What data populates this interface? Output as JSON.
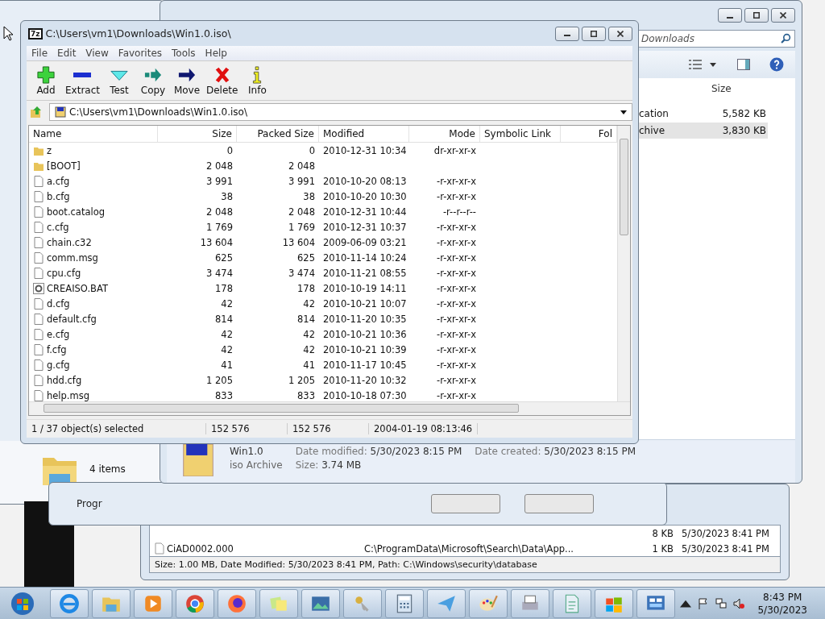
{
  "explorer_window": {
    "search": {
      "placeholder": "Downloads"
    },
    "columns": [
      "Size"
    ],
    "rows": [
      {
        "name": "cation",
        "size": "5,582 KB",
        "selected": false
      },
      {
        "name": "chive",
        "size": "3,830 KB",
        "selected": true
      }
    ],
    "details": {
      "name": "Win1.0",
      "type": "iso Archive",
      "fields": [
        {
          "label": "Date modified:",
          "value": "5/30/2023 8:15 PM"
        },
        {
          "label": "Size:",
          "value": "3.74 MB"
        },
        {
          "label": "Date created:",
          "value": "5/30/2023 8:15 PM"
        }
      ]
    }
  },
  "left_window": {
    "item_count": "4 items"
  },
  "dialog": {
    "label": "Progr"
  },
  "search_results": {
    "rows": [
      {
        "size": "8 KB",
        "modified": "5/30/2023 8:41 PM"
      },
      {
        "name": "CiAD0002.000",
        "path": "C:\\ProgramData\\Microsoft\\Search\\Data\\App...",
        "size": "1 KB",
        "modified": "5/30/2023 8:41 PM"
      }
    ],
    "status": "Size: 1.00 MB, Date Modified: 5/30/2023 8:41 PM, Path: C:\\Windows\\security\\database"
  },
  "archive_window": {
    "logo": "7z",
    "title": "C:\\Users\\vm1\\Downloads\\Win1.0.iso\\",
    "menu": [
      "File",
      "Edit",
      "View",
      "Favorites",
      "Tools",
      "Help"
    ],
    "toolbar": [
      {
        "label": "Add",
        "kind": "add"
      },
      {
        "label": "Extract",
        "kind": "extract"
      },
      {
        "label": "Test",
        "kind": "test"
      },
      {
        "label": "Copy",
        "kind": "copy"
      },
      {
        "label": "Move",
        "kind": "move"
      },
      {
        "label": "Delete",
        "kind": "delete"
      },
      {
        "label": "Info",
        "kind": "info"
      }
    ],
    "address": "C:\\Users\\vm1\\Downloads\\Win1.0.iso\\",
    "columns": [
      "Name",
      "Size",
      "Packed Size",
      "Modified",
      "Mode",
      "Symbolic Link",
      "Fol"
    ],
    "rows": [
      {
        "kind": "folder",
        "name": "z",
        "size": "0",
        "packed_size": "0",
        "modified": "2010-12-31 10:34",
        "mode": "dr-xr-xr-x"
      },
      {
        "kind": "folder",
        "name": "[BOOT]",
        "size": "2 048",
        "packed_size": "2 048"
      },
      {
        "kind": "file",
        "name": "a.cfg",
        "size": "3 991",
        "packed_size": "3 991",
        "modified": "2010-10-20 08:13",
        "mode": "-r-xr-xr-x"
      },
      {
        "kind": "file",
        "name": "b.cfg",
        "size": "38",
        "packed_size": "38",
        "modified": "2010-10-20 10:30",
        "mode": "-r-xr-xr-x"
      },
      {
        "kind": "file",
        "name": "boot.catalog",
        "size": "2 048",
        "packed_size": "2 048",
        "modified": "2010-12-31 10:44",
        "mode": "-r--r--r--"
      },
      {
        "kind": "file",
        "name": "c.cfg",
        "size": "1 769",
        "packed_size": "1 769",
        "modified": "2010-12-31 10:37",
        "mode": "-r-xr-xr-x"
      },
      {
        "kind": "file",
        "name": "chain.c32",
        "size": "13 604",
        "packed_size": "13 604",
        "modified": "2009-06-09 03:21",
        "mode": "-r-xr-xr-x"
      },
      {
        "kind": "file",
        "name": "comm.msg",
        "size": "625",
        "packed_size": "625",
        "modified": "2010-11-14 10:24",
        "mode": "-r-xr-xr-x"
      },
      {
        "kind": "file",
        "name": "cpu.cfg",
        "size": "3 474",
        "packed_size": "3 474",
        "modified": "2010-11-21 08:55",
        "mode": "-r-xr-xr-x"
      },
      {
        "kind": "batch",
        "name": "CREAISO.BAT",
        "size": "178",
        "packed_size": "178",
        "modified": "2010-10-19 14:11",
        "mode": "-r-xr-xr-x"
      },
      {
        "kind": "file",
        "name": "d.cfg",
        "size": "42",
        "packed_size": "42",
        "modified": "2010-10-21 10:07",
        "mode": "-r-xr-xr-x"
      },
      {
        "kind": "file",
        "name": "default.cfg",
        "size": "814",
        "packed_size": "814",
        "modified": "2010-11-20 10:35",
        "mode": "-r-xr-xr-x"
      },
      {
        "kind": "file",
        "name": "e.cfg",
        "size": "42",
        "packed_size": "42",
        "modified": "2010-10-21 10:36",
        "mode": "-r-xr-xr-x"
      },
      {
        "kind": "file",
        "name": "f.cfg",
        "size": "42",
        "packed_size": "42",
        "modified": "2010-10-21 10:39",
        "mode": "-r-xr-xr-x"
      },
      {
        "kind": "file",
        "name": "g.cfg",
        "size": "41",
        "packed_size": "41",
        "modified": "2010-11-17 10:45",
        "mode": "-r-xr-xr-x"
      },
      {
        "kind": "file",
        "name": "hdd.cfg",
        "size": "1 205",
        "packed_size": "1 205",
        "modified": "2010-11-20 10:32",
        "mode": "-r-xr-xr-x"
      },
      {
        "kind": "file",
        "name": "help.msg",
        "size": "833",
        "packed_size": "833",
        "modified": "2010-10-18 07:30",
        "mode": "-r-xr-xr-x"
      }
    ],
    "status": [
      "1 / 37 object(s) selected",
      "152 576",
      "152 576",
      "2004-01-19 08:13:46"
    ]
  },
  "taskbar": {
    "time": "8:43 PM",
    "date": "5/30/2023"
  }
}
